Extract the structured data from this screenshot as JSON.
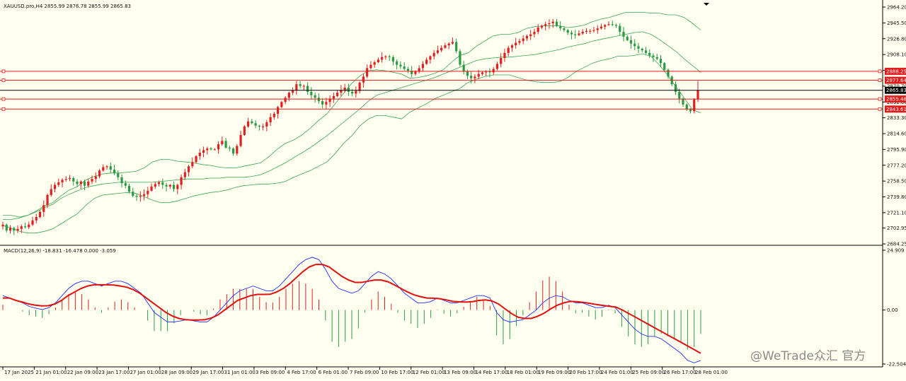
{
  "header": {
    "symbol_info": "XAUUSD.pro,H4  2855.99 2876.78 2855.99 2865.83"
  },
  "macd_header": "MACD(12,26,9) -18.831 -16.478 0.000 -3.059",
  "watermark": "@WeTrade众汇 官方",
  "chart_data": [
    {
      "type": "candlestick",
      "title": "XAUUSD.pro,H4",
      "ohlc_last": {
        "open": 2855.99,
        "high": 2876.78,
        "low": 2855.99,
        "close": 2865.83
      },
      "ylim": [
        2684.25,
        2964.2
      ],
      "y_ticks": [
        "2964.20",
        "2945.50",
        "2926.80",
        "2908.10",
        "2889.40",
        "2870.70",
        "2852.00",
        "2833.30",
        "2814.60",
        "2795.90",
        "2777.20",
        "2758.50",
        "2739.80",
        "2721.10",
        "2702.95",
        "2684.25"
      ],
      "x_ticks": [
        "17 Jan 2025",
        "21 Jan 01:00",
        "22 Jan 09:00",
        "23 Jan 17:00",
        "27 Jan 01:00",
        "28 Jan 09:00",
        "29 Jan 17:00",
        "31 Jan 01:00",
        "3 Feb 09:00",
        "4 Feb 17:00",
        "6 Feb 01:00",
        "7 Feb 09:00",
        "10 Feb 17:00",
        "12 Feb 01:00",
        "13 Feb 09:00",
        "14 Feb 17:00",
        "18 Feb 01:00",
        "19 Feb 09:00",
        "20 Feb 17:00",
        "24 Feb 01:00",
        "25 Feb 09:00",
        "26 Feb 17:00",
        "28 Feb 01:00"
      ],
      "price_labels": [
        {
          "value": 2888.25,
          "text": "2888.25",
          "kind": "red"
        },
        {
          "value": 2877.64,
          "text": "2877.64",
          "kind": "red"
        },
        {
          "value": 2865.83,
          "text": "2865.83",
          "kind": "black"
        },
        {
          "value": 2855.48,
          "text": "2855.48",
          "kind": "red"
        },
        {
          "value": 2843.61,
          "text": "2843.61",
          "kind": "red"
        }
      ],
      "close_series": [
        2707,
        2700,
        2703,
        2700,
        2702,
        2705,
        2704,
        2707,
        2712,
        2716,
        2722,
        2730,
        2742,
        2749,
        2754,
        2757,
        2760,
        2761,
        2762,
        2758,
        2755,
        2758,
        2753,
        2758,
        2761,
        2764,
        2771,
        2775,
        2776,
        2772,
        2768,
        2763,
        2756,
        2753,
        2746,
        2741,
        2740,
        2741,
        2743,
        2747,
        2752,
        2755,
        2757,
        2754,
        2752,
        2754,
        2749,
        2754,
        2763,
        2769,
        2776,
        2781,
        2788,
        2792,
        2795,
        2797,
        2796,
        2796,
        2802,
        2806,
        2798,
        2797,
        2791,
        2800,
        2813,
        2823,
        2829,
        2827,
        2824,
        2823,
        2823,
        2828,
        2834,
        2838,
        2846,
        2852,
        2857,
        2863,
        2866,
        2873,
        2871,
        2871,
        2864,
        2860,
        2857,
        2853,
        2849,
        2852,
        2856,
        2859,
        2863,
        2866,
        2869,
        2864,
        2862,
        2865,
        2875,
        2882,
        2892,
        2896,
        2899,
        2902,
        2905,
        2906,
        2905,
        2900,
        2896,
        2894,
        2891,
        2889,
        2885,
        2888,
        2892,
        2897,
        2902,
        2906,
        2910,
        2913,
        2916,
        2919,
        2921,
        2923,
        2912,
        2896,
        2888,
        2883,
        2880,
        2882,
        2885,
        2887,
        2888,
        2887,
        2891,
        2897,
        2904,
        2910,
        2916,
        2919,
        2922,
        2924,
        2927,
        2930,
        2932,
        2935,
        2940,
        2942,
        2944,
        2945,
        2947,
        2942,
        2939,
        2937,
        2934,
        2932,
        2931,
        2933,
        2935,
        2936,
        2936,
        2937,
        2939,
        2941,
        2943,
        2944,
        2943,
        2942,
        2935,
        2929,
        2925,
        2921,
        2918,
        2915,
        2913,
        2910,
        2907,
        2905,
        2903,
        2898,
        2890,
        2882,
        2873,
        2864,
        2856,
        2849,
        2843,
        2841,
        2855,
        2866
      ],
      "bb_upper": [
        2718,
        2718,
        2716,
        2718,
        2723,
        2729,
        2733,
        2741,
        2748,
        2752,
        2760,
        2764,
        2767,
        2768,
        2768,
        2769,
        2770,
        2774,
        2781,
        2784,
        2784,
        2782,
        2781,
        2780,
        2778,
        2777,
        2775,
        2774,
        2774,
        2776,
        2778,
        2780,
        2787,
        2796,
        2803,
        2807,
        2813,
        2821,
        2830,
        2838,
        2850,
        2862,
        2874,
        2883,
        2889,
        2890,
        2889,
        2887,
        2885,
        2880,
        2881,
        2883,
        2886,
        2890,
        2899,
        2907,
        2910,
        2918,
        2924,
        2930,
        2932,
        2932,
        2934,
        2939,
        2941,
        2942,
        2942,
        2942,
        2940,
        2941,
        2943,
        2947,
        2950,
        2952,
        2955,
        2958,
        2958,
        2958,
        2957,
        2957,
        2955,
        2955,
        2952,
        2945,
        2937
      ],
      "bb_middle": [
        2713,
        2713,
        2715,
        2718,
        2722,
        2727,
        2731,
        2738,
        2743,
        2747,
        2751,
        2753,
        2755,
        2756,
        2757,
        2757,
        2757,
        2757,
        2757,
        2758,
        2759,
        2760,
        2761,
        2761,
        2761,
        2762,
        2762,
        2763,
        2763,
        2763,
        2764,
        2766,
        2770,
        2775,
        2780,
        2786,
        2792,
        2798,
        2805,
        2812,
        2820,
        2828,
        2836,
        2844,
        2853,
        2860,
        2863,
        2866,
        2869,
        2872,
        2875,
        2878,
        2881,
        2885,
        2889,
        2893,
        2897,
        2901,
        2903,
        2904,
        2905,
        2905,
        2906,
        2907,
        2908,
        2910,
        2912,
        2914,
        2917,
        2919,
        2921,
        2924,
        2926,
        2928,
        2930,
        2932,
        2934,
        2935,
        2932,
        2926,
        2919,
        2912,
        2903,
        2895,
        2887
      ],
      "bb_lower": [
        2706,
        2703,
        2699,
        2697,
        2697,
        2699,
        2702,
        2708,
        2714,
        2720,
        2730,
        2738,
        2742,
        2743,
        2744,
        2745,
        2744,
        2740,
        2736,
        2733,
        2733,
        2735,
        2738,
        2741,
        2743,
        2745,
        2746,
        2748,
        2751,
        2753,
        2754,
        2755,
        2755,
        2756,
        2758,
        2763,
        2767,
        2771,
        2776,
        2781,
        2791,
        2803,
        2812,
        2824,
        2832,
        2836,
        2836,
        2834,
        2832,
        2840,
        2845,
        2850,
        2856,
        2860,
        2864,
        2868,
        2875,
        2879,
        2882,
        2884,
        2884,
        2884,
        2881,
        2878,
        2876,
        2875,
        2875,
        2876,
        2881,
        2888,
        2893,
        2898,
        2901,
        2903,
        2906,
        2906,
        2907,
        2909,
        2906,
        2896,
        2884,
        2870,
        2857,
        2843,
        2839
      ]
    },
    {
      "type": "macd",
      "title": "MACD(12,26,9)",
      "params": [
        12,
        26,
        9
      ],
      "values_header": [
        -18.831,
        -16.478,
        0.0,
        -3.059
      ],
      "ylim": [
        -22.504,
        24.909
      ],
      "y_ticks": [
        "24.909",
        "0.00",
        "-22.504"
      ],
      "macd_line": [
        6,
        5,
        4,
        3,
        1.5,
        0.8,
        0.2,
        1,
        3,
        6,
        9,
        11,
        12,
        12,
        11,
        10,
        11,
        12,
        12,
        11,
        9,
        7,
        3,
        -1,
        -3,
        -5,
        -5,
        -4.5,
        -4,
        -4.5,
        -5,
        -5,
        -3,
        0,
        3,
        6,
        8,
        9,
        10,
        9,
        8,
        8,
        10,
        13,
        16,
        19,
        21,
        22,
        21,
        17,
        12,
        9,
        8,
        7,
        8,
        11,
        14,
        16,
        15,
        13,
        10,
        7,
        5,
        3,
        3,
        3.5,
        5,
        4,
        3,
        3,
        4,
        5,
        6,
        6,
        5,
        -1,
        -4,
        -5,
        -4.5,
        -4,
        -2,
        0,
        3,
        5,
        6,
        5.5,
        4,
        3,
        3,
        2,
        1,
        1,
        2,
        1,
        -2,
        -5,
        -8,
        -10,
        -11,
        -11,
        -12,
        -14,
        -16,
        -18,
        -21,
        -22,
        -21
      ],
      "signal_line": [
        5,
        5,
        4,
        3.3,
        2.5,
        2,
        1.7,
        1.8,
        2.5,
        4,
        6,
        7.5,
        9,
        10,
        10.5,
        10.5,
        10.5,
        10.4,
        10,
        9.5,
        8.5,
        7,
        5,
        3,
        1,
        -1,
        -2.5,
        -3.5,
        -4,
        -4.2,
        -4.2,
        -4,
        -3.3,
        -2,
        0,
        2,
        4,
        5,
        6,
        6.5,
        6.5,
        6.6,
        7.5,
        9,
        11,
        13.5,
        16,
        18,
        19,
        19,
        18,
        16,
        14,
        12.5,
        11.5,
        11.5,
        12,
        12.5,
        12.5,
        11.8,
        10.5,
        9,
        7.6,
        6.4,
        5.6,
        5,
        4.9,
        4.7,
        4.2,
        3.6,
        3.4,
        3.3,
        3.5,
        4,
        4.2,
        3.8,
        2.5,
        0.5,
        -1.5,
        -3,
        -3.5,
        -3.5,
        -2.6,
        -1.3,
        0.5,
        2,
        3,
        3.6,
        3.5,
        3.2,
        2.8,
        2.3,
        1.9,
        1.6,
        1.2,
        0,
        -1.5,
        -3,
        -4.5,
        -6,
        -7.5,
        -9,
        -10.5,
        -12,
        -13.5,
        -15,
        -16.5,
        -18
      ]
    }
  ]
}
